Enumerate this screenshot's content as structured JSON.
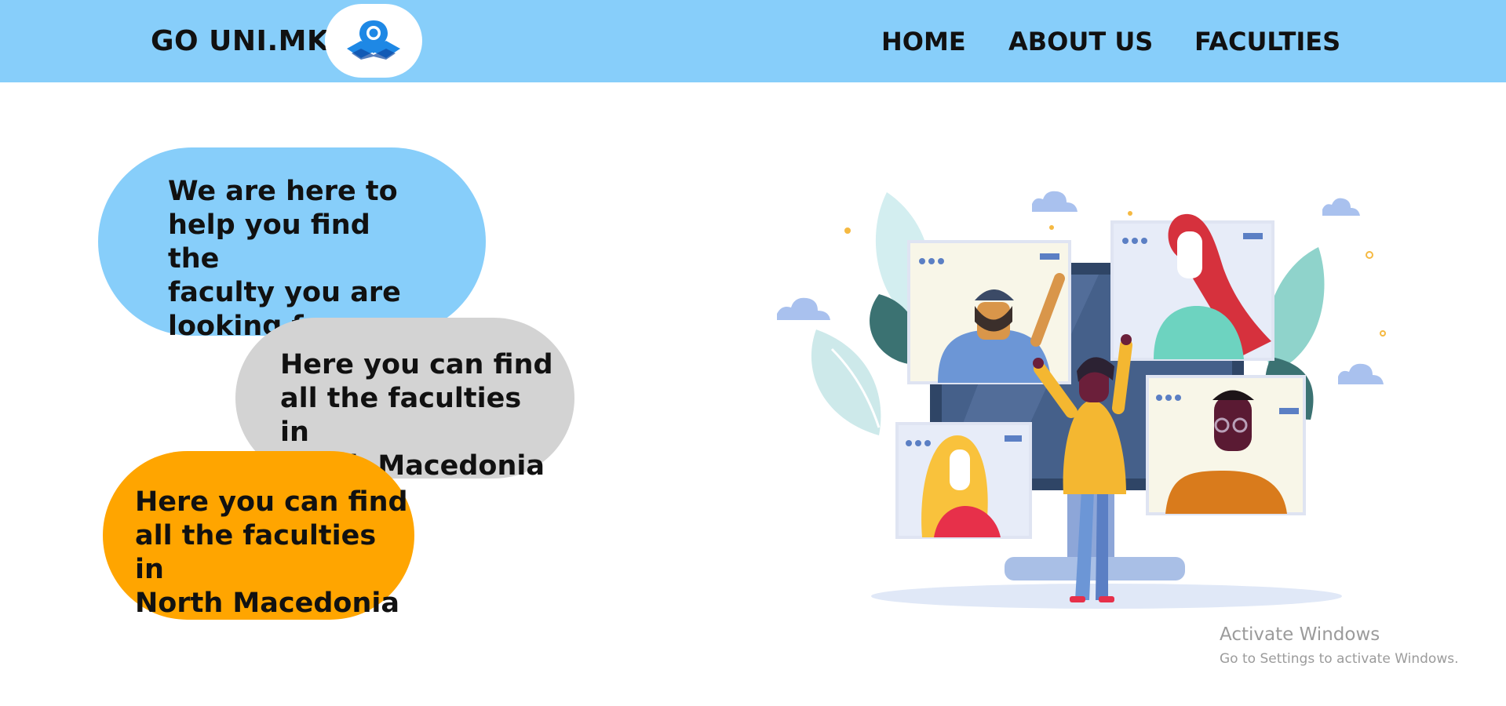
{
  "header": {
    "brand": "GO UNI.MK",
    "logo_icon": "map-pin-icon",
    "nav": [
      {
        "label": "HOME"
      },
      {
        "label": "ABOUT US"
      },
      {
        "label": "FACULTIES"
      }
    ]
  },
  "bubbles": [
    {
      "text": "We are here to\nhelp you find the\nfaculty you are\nlooking for",
      "color": "#87cefa"
    },
    {
      "text": "Here you can find\nall the faculties in\nNorth Macedonia",
      "color": "#d3d3d3"
    },
    {
      "text": "Here you can find\nall the faculties in\nNorth Macedonia",
      "color": "#ffa500"
    }
  ],
  "illustration": {
    "icon": "video-conference-illustration"
  },
  "watermark": {
    "title": "Activate Windows",
    "subtitle": "Go to Settings to activate Windows."
  }
}
